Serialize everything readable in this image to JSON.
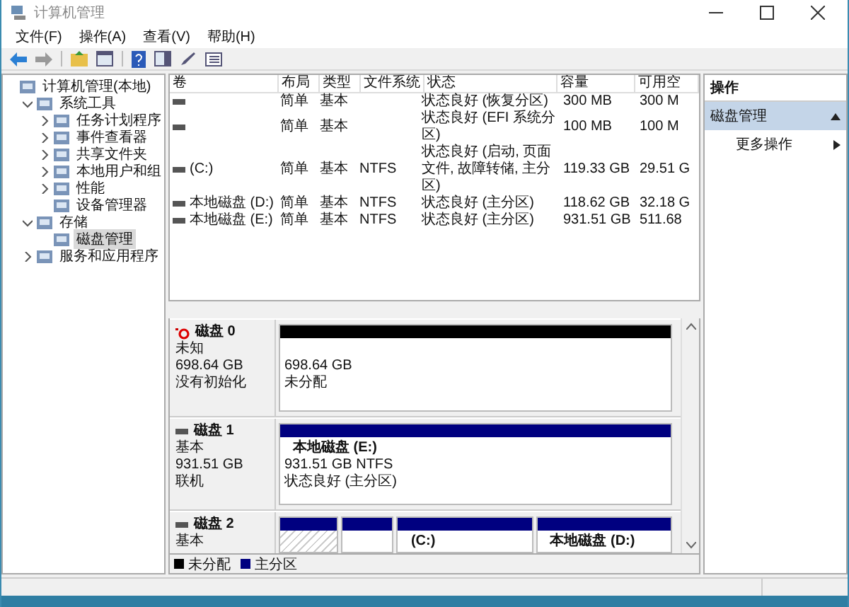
{
  "window": {
    "title": "计算机管理"
  },
  "menu": [
    "文件(F)",
    "操作(A)",
    "查看(V)",
    "帮助(H)"
  ],
  "tree": {
    "items": [
      {
        "label": "计算机管理(本地)",
        "selected": false,
        "children": [
          {
            "label": "系统工具",
            "selected": false,
            "expanded": true,
            "children": [
              {
                "label": "任务计划程序",
                "selected": false,
                "expanded": false
              },
              {
                "label": "事件查看器",
                "selected": false,
                "expanded": false
              },
              {
                "label": "共享文件夹",
                "selected": false,
                "expanded": false
              },
              {
                "label": "本地用户和组",
                "selected": false,
                "expanded": false
              },
              {
                "label": "性能",
                "selected": false,
                "expanded": false
              },
              {
                "label": "设备管理器",
                "selected": false
              }
            ]
          },
          {
            "label": "存储",
            "selected": false,
            "expanded": true,
            "children": [
              {
                "label": "磁盘管理",
                "selected": true
              }
            ]
          },
          {
            "label": "服务和应用程序",
            "selected": false,
            "expanded": false
          }
        ]
      }
    ]
  },
  "table": {
    "columns": [
      "卷",
      "布局",
      "类型",
      "文件系统",
      "状态",
      "容量",
      "可用空"
    ],
    "rows": [
      [
        "",
        "简单",
        "基本",
        "",
        "状态良好 (恢复分区)",
        "300 MB",
        "300 M"
      ],
      [
        "",
        "简单",
        "基本",
        "",
        "状态良好 (EFI 系统分区)",
        "100 MB",
        "100 M"
      ],
      [
        "(C:)",
        "简单",
        "基本",
        "NTFS",
        "状态良好 (启动, 页面文件, 故障转储, 主分区)",
        "119.33 GB",
        "29.51 G"
      ],
      [
        "本地磁盘 (D:)",
        "简单",
        "基本",
        "NTFS",
        "状态良好 (主分区)",
        "118.62 GB",
        "32.18 G"
      ],
      [
        "本地磁盘 (E:)",
        "简单",
        "基本",
        "NTFS",
        "状态良好 (主分区)",
        "931.51 GB",
        "511.68"
      ]
    ]
  },
  "disks": [
    {
      "name": "磁盘 0",
      "kind": "unknown",
      "info": [
        "未知",
        "698.64 GB",
        "没有初始化"
      ],
      "partitions": [
        {
          "kind": "unallocated",
          "lines": [
            "698.64 GB",
            "未分配"
          ]
        }
      ]
    },
    {
      "name": "磁盘 1",
      "kind": "basic",
      "info": [
        "基本",
        "931.51 GB",
        "联机"
      ],
      "partitions": [
        {
          "kind": "primary",
          "name": "本地磁盘  (E:)",
          "lines": [
            "931.51 GB NTFS",
            "状态良好 (主分区)"
          ]
        }
      ]
    },
    {
      "name": "磁盘 2",
      "kind": "basic",
      "info": [
        "基本"
      ],
      "partitions": [
        {
          "kind": "hatched"
        },
        {
          "kind": "primary"
        },
        {
          "kind": "primary",
          "name": "(C:)"
        },
        {
          "kind": "primary",
          "name": "本地磁盘  (D:)"
        }
      ]
    }
  ],
  "legend": [
    {
      "label": "未分配",
      "color": "#000000"
    },
    {
      "label": "主分区",
      "color": "#000080"
    }
  ],
  "actions": {
    "title": "操作",
    "sections": [
      {
        "label": "磁盘管理",
        "expanded": true,
        "items": [
          "更多操作"
        ]
      }
    ]
  }
}
